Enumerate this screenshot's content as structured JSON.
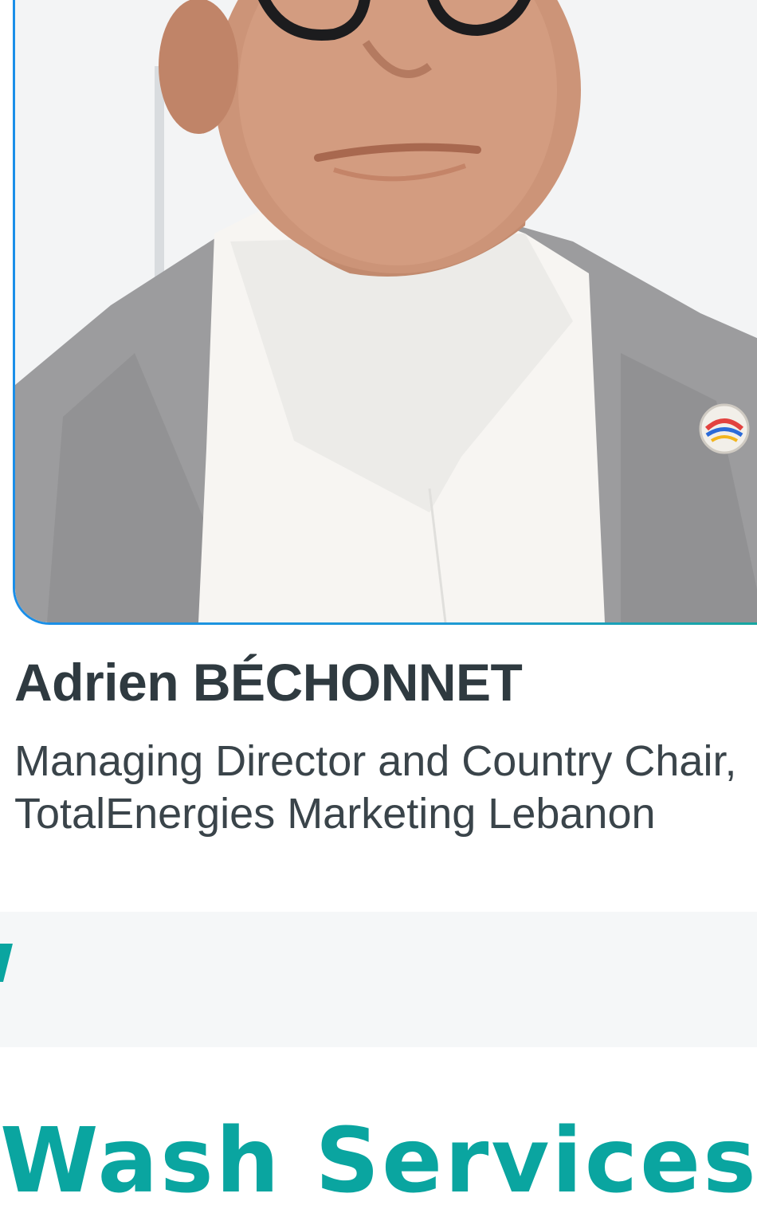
{
  "profile": {
    "photo_alt": "Portrait photo",
    "name": "Adrien BÉCHONNET",
    "role_line_1": "Managing Director and Country Chair,",
    "role_line_2": "TotalEnergies Marketing Lebanon"
  },
  "section": {
    "heading": "Wash Services"
  },
  "colors": {
    "frame_border_start": "#1a8ee8",
    "frame_border_end": "#15a89a",
    "accent_teal": "#0aa5a0",
    "name_text": "#2f3a40",
    "band_background": "#f5f7f8"
  }
}
